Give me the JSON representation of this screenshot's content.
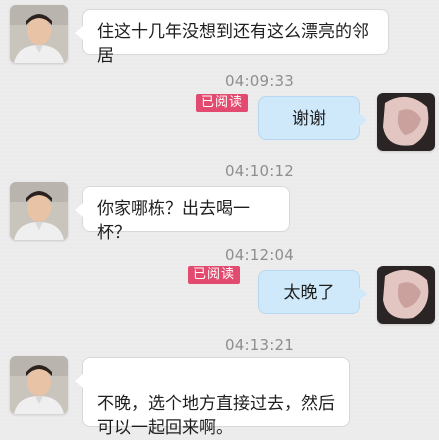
{
  "colors": {
    "background": "#ebebeb",
    "incoming_bubble": "#ffffff",
    "outgoing_bubble": "#cfe9fb",
    "read_badge": "#e34a6f",
    "timestamp": "#8e8e8e"
  },
  "messages": [
    {
      "sender": "contact",
      "text": "住这十几年没想到还有这么漂亮的邻居"
    },
    {
      "timestamp": "04:09:33"
    },
    {
      "sender": "me",
      "status": "已阅读",
      "text": "谢谢"
    },
    {
      "timestamp": "04:10:12"
    },
    {
      "sender": "contact",
      "text": "你家哪栋？出去喝一杯？"
    },
    {
      "timestamp": "04:12:04"
    },
    {
      "sender": "me",
      "status": "已阅读",
      "text": "太晚了"
    },
    {
      "timestamp": "04:13:21"
    },
    {
      "sender": "contact",
      "text": "不晚，选个地方直接过去，然后\n可以一起回来啊。"
    }
  ]
}
